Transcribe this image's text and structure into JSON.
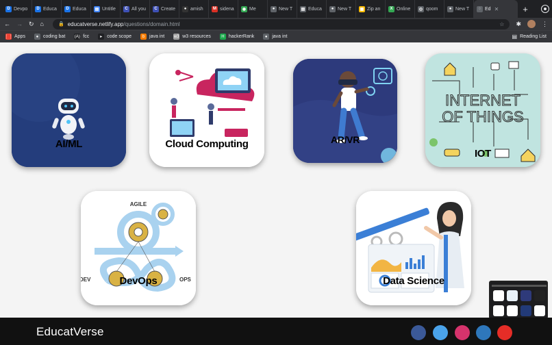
{
  "browser": {
    "tabs": [
      {
        "label": "Devpo",
        "icon": "D",
        "color": "#1a73e8"
      },
      {
        "label": "Educa",
        "icon": "D",
        "color": "#1a73e8"
      },
      {
        "label": "Educa",
        "icon": "D",
        "color": "#1a73e8"
      },
      {
        "label": "Untitle",
        "icon": "▤",
        "color": "#4285f4"
      },
      {
        "label": "All you",
        "icon": "C",
        "color": "#3f51b5"
      },
      {
        "label": "Create",
        "icon": "C",
        "color": "#3f51b5"
      },
      {
        "label": "amish",
        "icon": "●",
        "color": "#333"
      },
      {
        "label": "sidena",
        "icon": "M",
        "color": "#d93025"
      },
      {
        "label": "Me",
        "icon": "◉",
        "color": "#34a853"
      },
      {
        "label": "New T",
        "icon": "●",
        "color": "#5f6368"
      },
      {
        "label": "Educa",
        "icon": "▤",
        "color": "#5f6368"
      },
      {
        "label": "New T",
        "icon": "●",
        "color": "#5f6368"
      },
      {
        "label": "Zip an",
        "icon": "▦",
        "color": "#fbbc04"
      },
      {
        "label": "Online",
        "icon": "X",
        "color": "#34a853"
      },
      {
        "label": "qoom",
        "icon": "◎",
        "color": "#5f6368"
      },
      {
        "label": "New T",
        "icon": "●",
        "color": "#5f6368"
      },
      {
        "label": "Ed",
        "icon": "◌",
        "color": "#5f6368",
        "active": true
      }
    ],
    "new_tab": "+",
    "url_host": "educatverse.netlify.app",
    "url_path": "/questions/domain.html",
    "bookmarks": [
      {
        "label": "Apps",
        "icon": "⋮⋮",
        "color": "#ea4335"
      },
      {
        "label": "coding bat",
        "icon": "●",
        "color": "#5f6368"
      },
      {
        "label": "fcc",
        "icon": "(A)",
        "color": "#202124"
      },
      {
        "label": "code scope",
        "icon": "▸",
        "color": "#202124"
      },
      {
        "label": "java int",
        "icon": "b",
        "color": "#f57c00"
      },
      {
        "label": "w3 resources",
        "icon": "w3",
        "color": "#9e9e9e"
      },
      {
        "label": "hackerRank",
        "icon": "H",
        "color": "#1ba94c"
      },
      {
        "label": "java int",
        "icon": "●",
        "color": "#5f6368"
      }
    ],
    "reading_list": "Reading List"
  },
  "domains": [
    {
      "label": "AI/ML",
      "bg": "#223a78"
    },
    {
      "label": "Cloud Computing",
      "bg": "#ffffff"
    },
    {
      "label": "AR/VR",
      "bg": "#2e3a7a"
    },
    {
      "label": "IOT",
      "bg": "#bfe3e0"
    },
    {
      "label": "DevOps",
      "bg": "#ffffff"
    },
    {
      "label": "Data Science",
      "bg": "#ffffff"
    }
  ],
  "devops_text": {
    "agile": "AGILE",
    "dev": "DEV",
    "ops": "OPS"
  },
  "iot_text": {
    "line1": "INTERNET",
    "line2": "OF THINGS"
  },
  "footer": {
    "brand": "EducatVerse",
    "social": [
      {
        "name": "facebook",
        "color": "#3b5998"
      },
      {
        "name": "twitter",
        "color": "#4aa3ea"
      },
      {
        "name": "instagram",
        "color": "#d6336c"
      },
      {
        "name": "linkedin",
        "color": "#2e77bb"
      },
      {
        "name": "youtube",
        "color": "#e52d27"
      }
    ]
  }
}
